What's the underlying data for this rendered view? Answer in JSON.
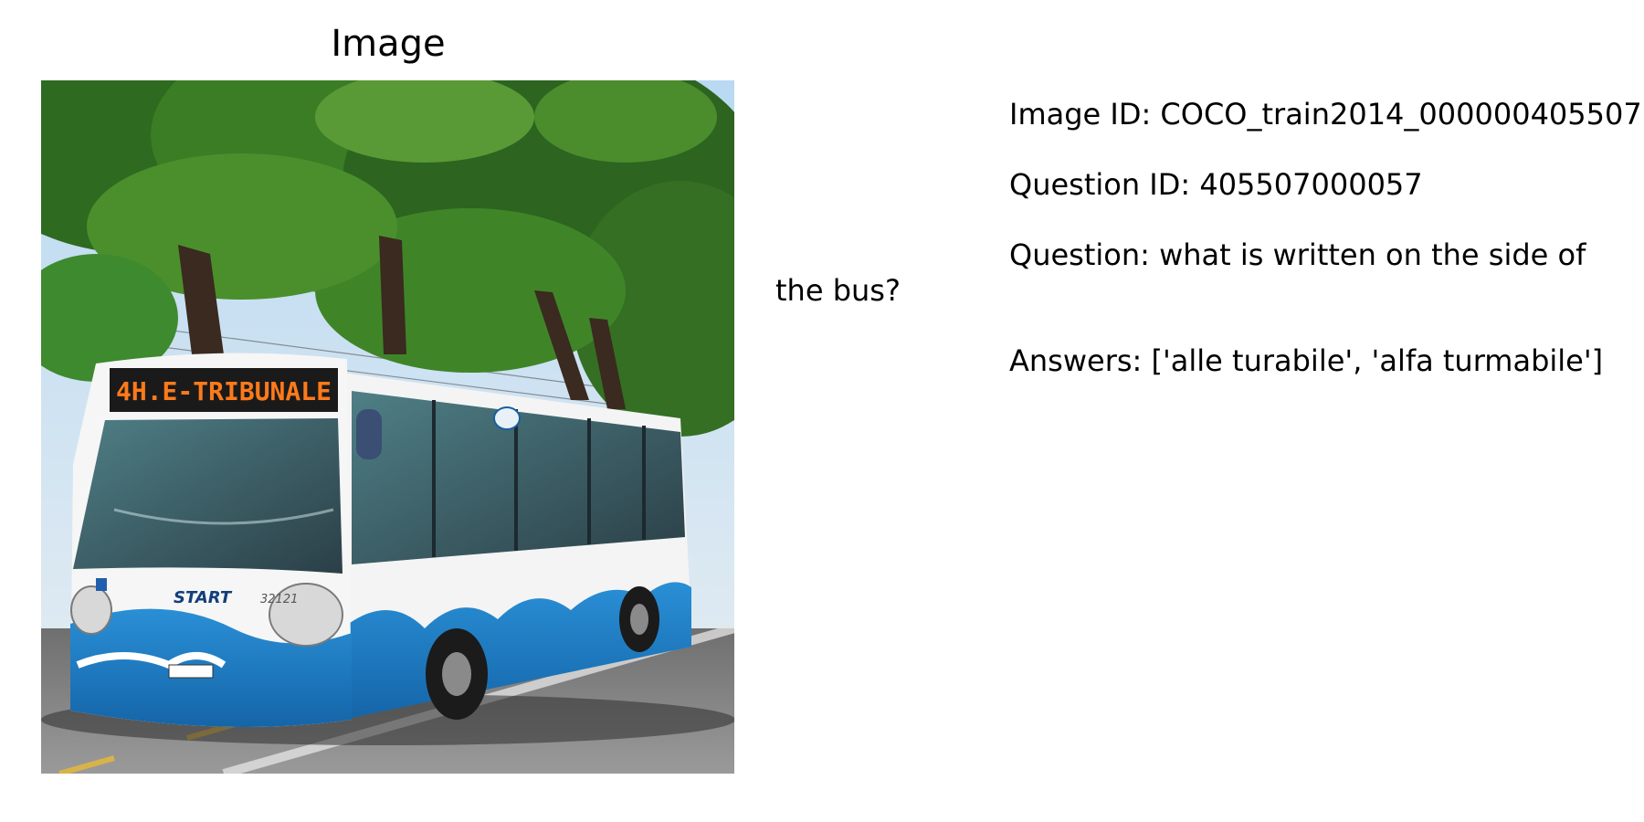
{
  "panel": {
    "title": "Image"
  },
  "photo": {
    "destination_sign": "4H.E-TRIBUNALE",
    "brand": "START",
    "fleet_number": "32121"
  },
  "info": {
    "image_id": "Image ID: COCO_train2014_000000405507",
    "question_id": "Question ID: 405507000057",
    "question": "Question: what is written on the side of the bus?",
    "answers": "Answers: ['alle turabile', 'alfa turmabile']"
  }
}
